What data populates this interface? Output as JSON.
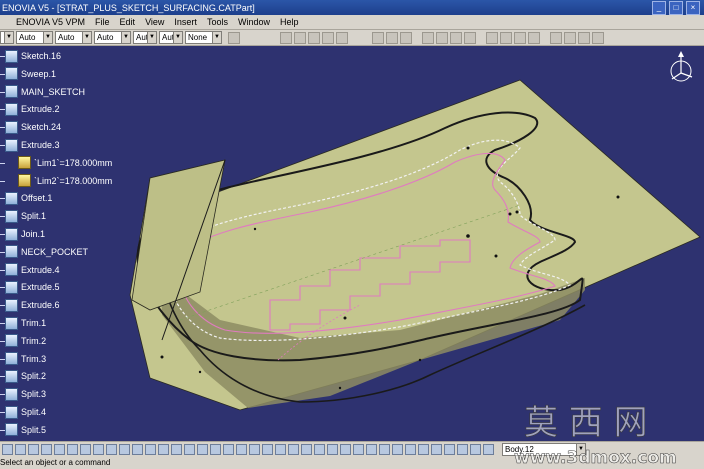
{
  "window": {
    "title": "ENOVIA V5 - [STRAT_PLUS_SKETCH_SURFACING.CATPart]",
    "controls": [
      "_",
      "□",
      "×"
    ]
  },
  "menu": [
    "ENOVIA V5 VPM",
    "File",
    "Edit",
    "View",
    "Insert",
    "Tools",
    "Window",
    "Help"
  ],
  "toolbar": {
    "combos": [
      "Auto",
      "Auto",
      "Auto",
      "Aut",
      "Aut",
      "None"
    ]
  },
  "tree": [
    {
      "label": "Sketch.16",
      "kind": "sketch"
    },
    {
      "label": "Sweep.1",
      "kind": "surface"
    },
    {
      "label": "MAIN_SKETCH",
      "kind": "sketch"
    },
    {
      "label": "Extrude.2",
      "kind": "surface"
    },
    {
      "label": "Sketch.24",
      "kind": "sketch"
    },
    {
      "label": "Extrude.3",
      "kind": "surface"
    },
    {
      "label": "`Lim1`=178.000mm",
      "kind": "parameter"
    },
    {
      "label": "`Lim2`=178.000mm",
      "kind": "parameter"
    },
    {
      "label": "Offset.1",
      "kind": "surface"
    },
    {
      "label": "Split.1",
      "kind": "surface"
    },
    {
      "label": "Join.1",
      "kind": "surface"
    },
    {
      "label": "NECK_POCKET",
      "kind": "sketch"
    },
    {
      "label": "Extrude.4",
      "kind": "surface"
    },
    {
      "label": "Extrude.5",
      "kind": "surface"
    },
    {
      "label": "Extrude.6",
      "kind": "surface"
    },
    {
      "label": "Trim.1",
      "kind": "surface"
    },
    {
      "label": "Trim.2",
      "kind": "surface"
    },
    {
      "label": "Trim.3",
      "kind": "surface"
    },
    {
      "label": "Split.2",
      "kind": "surface"
    },
    {
      "label": "Split.3",
      "kind": "surface"
    },
    {
      "label": "Split.4",
      "kind": "surface"
    },
    {
      "label": "Split.5",
      "kind": "surface"
    }
  ],
  "bottom_toolbar": {
    "body_select": "Body.12"
  },
  "status": {
    "text": "Select an object or a command"
  },
  "watermark": {
    "cn": "莫 西 网",
    "url": "www.3dmox.com"
  },
  "colors": {
    "viewport_bg": "#2e3270",
    "plane_fill": "#c4c68e",
    "sketch_pink": "#e07bc0",
    "outline": "#1a1a1a"
  }
}
